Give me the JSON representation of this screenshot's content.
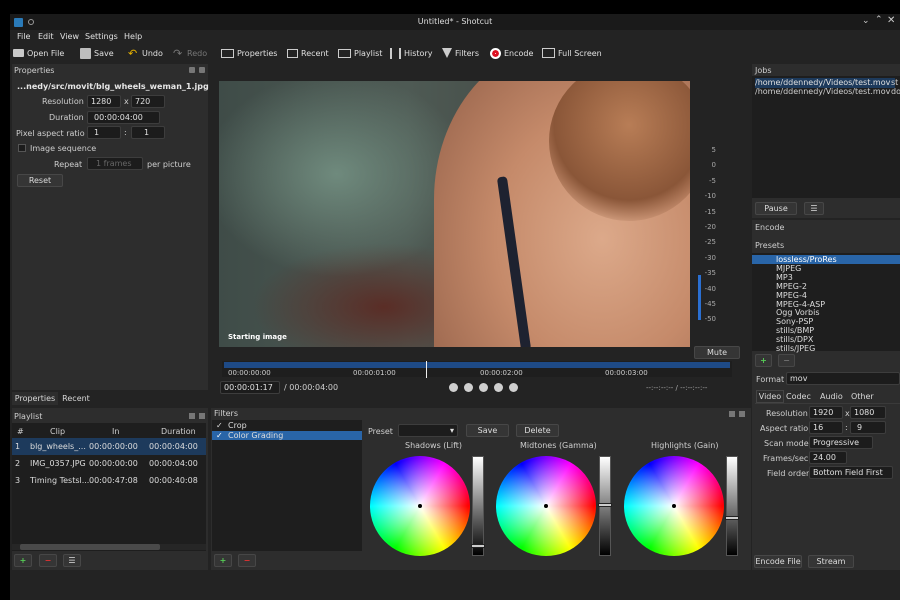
{
  "window": {
    "title": "Untitled* - Shotcut"
  },
  "menu": [
    "File",
    "Edit",
    "View",
    "Settings",
    "Help"
  ],
  "toolbar": {
    "open": "Open File",
    "save": "Save",
    "undo": "Undo",
    "redo": "Redo",
    "properties": "Properties",
    "recent": "Recent",
    "playlist": "Playlist",
    "history": "History",
    "filters": "Filters",
    "encode": "Encode",
    "fullscreen": "Full Screen"
  },
  "properties": {
    "title": "Properties",
    "file": "...nedy/src/movit/blg_wheels_weman_1.jpg",
    "resolution_label": "Resolution",
    "res_w": "1280",
    "res_x": "x",
    "res_h": "720",
    "duration_label": "Duration",
    "duration": "00:00:04:00",
    "par_label": "Pixel aspect ratio",
    "par_w": "1",
    "par_colon": ":",
    "par_h": "1",
    "image_seq": "Image sequence",
    "repeat_label": "Repeat",
    "repeat_value": "1 frames",
    "per_picture": "per picture",
    "reset": "Reset"
  },
  "tabs_left": [
    "Properties",
    "Recent"
  ],
  "playlist": {
    "title": "Playlist",
    "headers": [
      "#",
      "Clip",
      "In",
      "Duration"
    ],
    "rows": [
      [
        "1",
        "blg_wheels_...",
        "00:00:00:00",
        "00:00:04:00"
      ],
      [
        "2",
        "IMG_0357.JPG",
        "00:00:00:00",
        "00:00:04:00"
      ],
      [
        "3",
        "Timing Testsl...",
        "00:00:47:08",
        "00:00:40:08"
      ]
    ]
  },
  "viewer": {
    "caption": "Starting image",
    "timecode": "00:00:01:17",
    "duration": "/ 00:00:04:00",
    "ruler": [
      "00:00:00:00",
      "00:00:01:00",
      "00:00:02:00",
      "00:00:03:00"
    ],
    "inout": "--:--:--:-- / --:--:--:--",
    "progress": 0.4
  },
  "meter": {
    "ticks": [
      "5",
      "0",
      "-5",
      "-10",
      "-15",
      "-20",
      "-25",
      "-30",
      "-35",
      "-40",
      "-45",
      "-50"
    ],
    "mute": "Mute"
  },
  "filters": {
    "title": "Filters",
    "items": [
      {
        "label": "Crop",
        "checked": true
      },
      {
        "label": "Color Grading",
        "checked": true
      }
    ],
    "preset_label": "Preset",
    "save": "Save",
    "delete": "Delete",
    "wheels": [
      {
        "label": "Shadows (Lift)",
        "level": 0.93
      },
      {
        "label": "Midtones (Gamma)",
        "level": 0.5
      },
      {
        "label": "Highlights (Gain)",
        "level": 0.64
      }
    ]
  },
  "jobs": {
    "title": "Jobs",
    "items": [
      {
        "path": "/home/ddennedy/Videos/test.mov",
        "status": "st"
      },
      {
        "path": "/home/ddennedy/Videos/test.mov",
        "status": "do"
      }
    ],
    "pause": "Pause"
  },
  "encode": {
    "title": "Encode",
    "presets_label": "Presets",
    "presets": [
      "lossless/ProRes",
      "MJPEG",
      "MP3",
      "MPEG-2",
      "MPEG-4",
      "MPEG-4-ASP",
      "Ogg Vorbis",
      "Sony-PSP",
      "stills/BMP",
      "stills/DPX",
      "stills/JPEG"
    ],
    "format_label": "Format",
    "format": "mov",
    "tabs": [
      "Video",
      "Codec",
      "Audio",
      "Other"
    ],
    "resolution_label": "Resolution",
    "res_w": "1920",
    "res_x": "x",
    "res_h": "1080",
    "aspect_label": "Aspect ratio",
    "asp_w": "16",
    "asp_colon": ":",
    "asp_h": "9",
    "scan_label": "Scan mode",
    "scan": "Progressive",
    "fps_label": "Frames/sec",
    "fps": "24.00",
    "field_label": "Field order",
    "field": "Bottom Field First",
    "encode_file": "Encode File",
    "stream": "Stream"
  }
}
